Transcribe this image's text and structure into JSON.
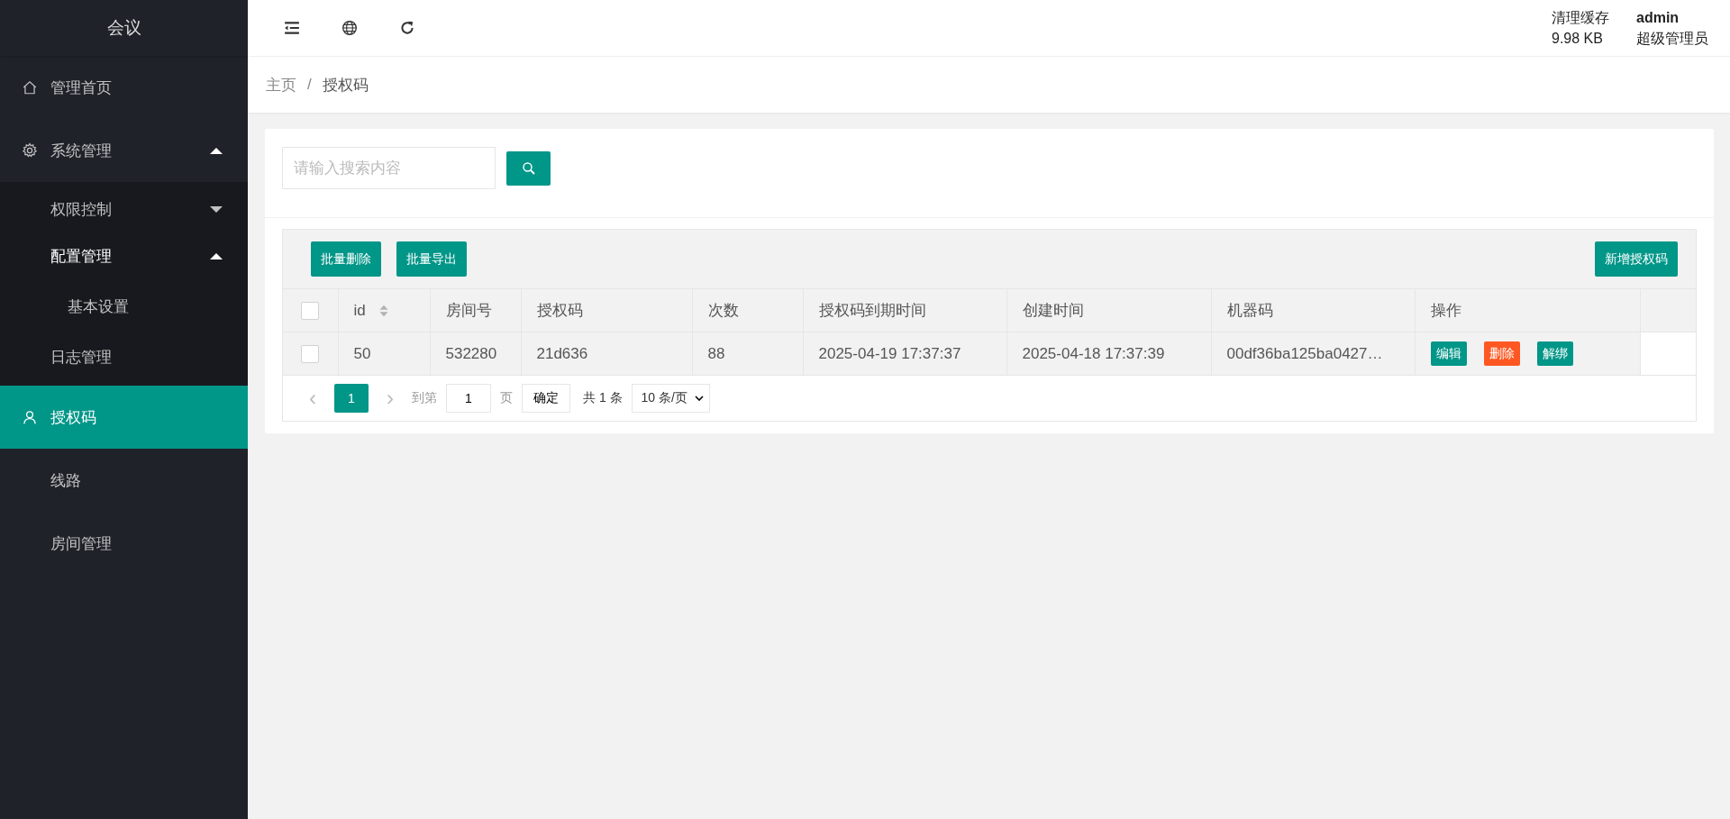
{
  "sidebar": {
    "logo": "会议",
    "items": [
      {
        "label": "管理首页",
        "kind": "home",
        "selected": false
      },
      {
        "label": "系统管理",
        "kind": "gear",
        "selected": false,
        "expanded": true,
        "children": [
          {
            "label": "权限控制",
            "kind": "group",
            "selected": false,
            "expanded": false
          },
          {
            "label": "配置管理",
            "kind": "group",
            "selected": false,
            "expanded": true,
            "children": [
              {
                "label": "基本设置",
                "selected": false
              }
            ]
          },
          {
            "label": "日志管理",
            "kind": "leaf",
            "selected": false
          }
        ]
      },
      {
        "label": "授权码",
        "kind": "user",
        "selected": true
      },
      {
        "label": "线路",
        "selected": false
      },
      {
        "label": "房间管理",
        "selected": false
      }
    ]
  },
  "header": {
    "cache_label": "清理缓存",
    "cache_size": "9.98 KB",
    "user": "admin",
    "role": "超级管理员"
  },
  "breadcrumb": [
    "主页",
    "授权码"
  ],
  "breadcrumb_separator": "/",
  "search": {
    "placeholder": "请输入搜索内容"
  },
  "toolbar": {
    "left_buttons": [
      "批量删除",
      "批量导出"
    ],
    "right_button": "新增授权码"
  },
  "table": {
    "select_all_checked": false,
    "columns": [
      {
        "label": "id",
        "sortable": true
      },
      {
        "label": "房间号",
        "sortable": false
      },
      {
        "label": "授权码",
        "sortable": false
      },
      {
        "label": "次数",
        "sortable": false
      },
      {
        "label": "授权码到期时间",
        "sortable": false
      },
      {
        "label": "创建时间",
        "sortable": false
      },
      {
        "label": "机器码",
        "sortable": false
      },
      {
        "label": "操作",
        "sortable": false
      }
    ],
    "rows": [
      {
        "checked": false,
        "cells": [
          "50",
          "532280",
          "21d636",
          "88",
          "2025-04-19 17:37:37",
          "2025-04-18 17:37:39",
          "00df36ba125ba0427…"
        ],
        "actions": [
          {
            "label": "编辑",
            "kind": "normal"
          },
          {
            "label": "删除",
            "kind": "danger"
          },
          {
            "label": "解绑",
            "kind": "normal"
          }
        ]
      }
    ]
  },
  "pagination": {
    "prev": "‹",
    "next": "›",
    "pages": [
      {
        "label": "1",
        "selected": true
      }
    ],
    "goto_label": "到第",
    "goto_value": "1",
    "page_unit": "页",
    "confirm": "确定",
    "total": "共 1 条",
    "page_size": "10 条/页"
  }
}
